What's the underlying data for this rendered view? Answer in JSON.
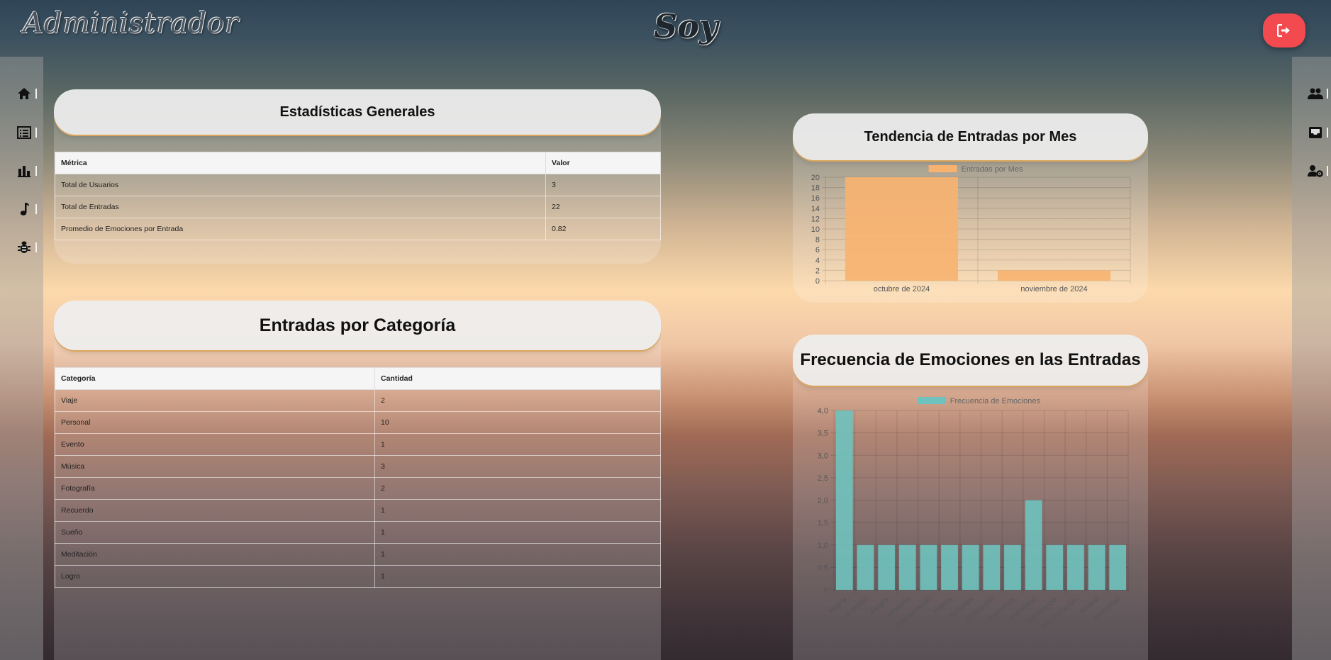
{
  "header": {
    "brand": "Administrador",
    "center_title": "Soy",
    "logout_icon": "logout-icon",
    "accent_color": "#f24a4f"
  },
  "sidebar_left": {
    "items": [
      {
        "icon": "home-icon"
      },
      {
        "icon": "list-icon"
      },
      {
        "icon": "bar-chart-icon"
      },
      {
        "icon": "music-note-icon"
      },
      {
        "icon": "bug-icon"
      }
    ]
  },
  "sidebar_right": {
    "items": [
      {
        "icon": "users-icon"
      },
      {
        "icon": "inbox-icon"
      },
      {
        "icon": "user-settings-icon"
      }
    ]
  },
  "stats_card": {
    "title": "Estadísticas Generales",
    "headers": [
      "Métrica",
      "Valor"
    ],
    "rows": [
      [
        "Total de Usuarios",
        "3"
      ],
      [
        "Total de Entradas",
        "22"
      ],
      [
        "Promedio de Emociones por Entrada",
        "0.82"
      ]
    ]
  },
  "category_card": {
    "title": "Entradas por Categoría",
    "headers": [
      "Categoría",
      "Cantidad"
    ],
    "rows": [
      [
        "Viaje",
        "2"
      ],
      [
        "Personal",
        "10"
      ],
      [
        "Evento",
        "1"
      ],
      [
        "Música",
        "3"
      ],
      [
        "Fotografía",
        "2"
      ],
      [
        "Recuerdo",
        "1"
      ],
      [
        "Sueño",
        "1"
      ],
      [
        "Meditación",
        "1"
      ],
      [
        "Logro",
        "1"
      ]
    ]
  },
  "trend_card": {
    "title": "Tendencia de Entradas por Mes"
  },
  "emotions_card": {
    "title": "Frecuencia de Emociones en las Entradas"
  },
  "chart_data": [
    {
      "type": "bar",
      "legend": "Entradas por Mes",
      "categories": [
        "octubre de 2024",
        "noviembre de 2024"
      ],
      "series": [
        {
          "name": "Entradas por Mes",
          "values": [
            20,
            2
          ]
        }
      ],
      "ylim": [
        0,
        20
      ],
      "yticks": [
        "0",
        "2",
        "4",
        "6",
        "8",
        "10",
        "12",
        "14",
        "16",
        "18",
        "20"
      ],
      "color": "#f7b26f",
      "grid": true,
      "legend_position": "top"
    },
    {
      "type": "bar",
      "legend": "Frecuencia de Emociones",
      "categories": [
        "alegría",
        "diversión",
        "Alegría",
        "emoción",
        "determinación",
        "tristeza",
        "nostalgia",
        "motivación",
        "esperanza",
        "Neutralidad",
        "indiferencia",
        "determinación.",
        "Neutral",
        "curiosidad"
      ],
      "series": [
        {
          "name": "Frecuencia de Emociones",
          "values": [
            4,
            1,
            1,
            1,
            1,
            1,
            1,
            1,
            1,
            2,
            1,
            1,
            1,
            1
          ]
        }
      ],
      "ylim": [
        0,
        4
      ],
      "yticks": [
        "0",
        "0,5",
        "1,0",
        "1,5",
        "2,0",
        "2,5",
        "3,0",
        "3,5",
        "4,0"
      ],
      "color": "#6fc2be",
      "grid": true,
      "legend_position": "top"
    }
  ]
}
